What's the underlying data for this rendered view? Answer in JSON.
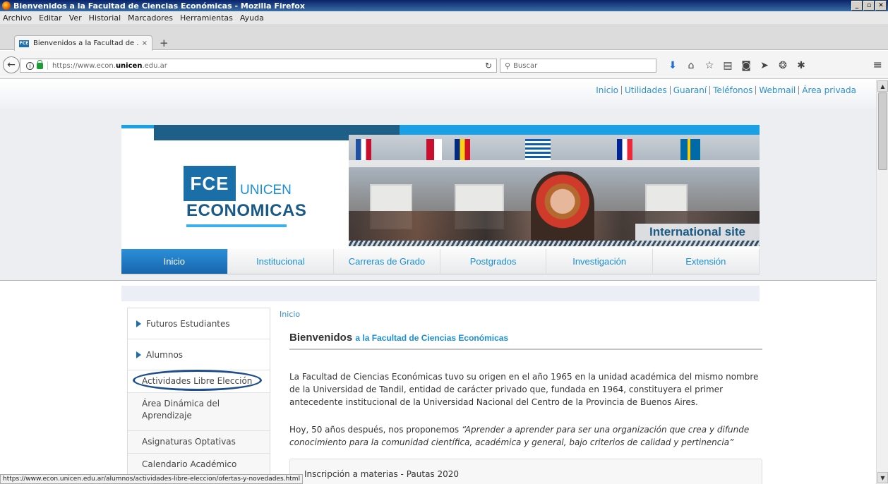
{
  "window": {
    "title": "Bienvenidos a la Facultad de Ciencias Económicas - Mozilla Firefox",
    "buttons": {
      "minimize": "_",
      "maximize": "▫",
      "close": "✕"
    }
  },
  "menu": [
    "Archivo",
    "Editar",
    "Ver",
    "Historial",
    "Marcadores",
    "Herramientas",
    "Ayuda"
  ],
  "tab": {
    "favicon": "FCE",
    "title": "Bienvenidos a la Facultad de ...",
    "close": "×",
    "new_tab": "+"
  },
  "navbar": {
    "url_prefix": "https://www.econ.",
    "url_domain": "unicen",
    "url_suffix": ".edu.ar",
    "search_placeholder": "Buscar",
    "icons": [
      "download-icon",
      "home-icon",
      "bookmark-star-icon",
      "reading-list-icon",
      "pocket-icon",
      "send-icon",
      "extension-icon",
      "addon-icon"
    ]
  },
  "page": {
    "top_links": [
      "Inicio",
      "Utilidades",
      "Guaraní",
      "Teléfonos",
      "Webmail",
      "Área privada"
    ],
    "logo": {
      "fce": "FCE",
      "unicen": "UNICEN",
      "economicas": "ECONOMICAS"
    },
    "hero_caption": "International site",
    "main_nav": [
      "Inicio",
      "Institucional",
      "Carreras de Grado",
      "Postgrados",
      "Investigación",
      "Extensión"
    ],
    "sidebar": {
      "section1": "Futuros Estudiantes",
      "section2": "Alumnos",
      "items": [
        "Actividades Libre Elección",
        "Área Dinámica del Aprendizaje",
        "Asignaturas Optativas",
        "Calendario Académico"
      ]
    },
    "breadcrumb": "Inicio",
    "title_main": "Bienvenidos",
    "title_sub": "a la Facultad de Ciencias Económicas",
    "para1": "La Facultad de Ciencias Económicas tuvo su origen en el año 1965 en la unidad académica del mismo nombre de la Universidad de Tandil, entidad de carácter privado que, fundada en 1964, constituyera el primer antecedente institucional de la Universidad Nacional del Centro de la Provincia de Buenos Aires.",
    "para2_intro": "Hoy, 50 años después, nos proponemos ",
    "para2_quote": "“Aprender a aprender para ser una organización que crea y difunde conocimiento para la comunidad científica, académica y general, bajo criterios de calidad y pertinencia”",
    "boxed_item": "Inscripción a materias - Pautas 2020"
  },
  "status_url": "https://www.econ.unicen.edu.ar/alumnos/actividades-libre-eleccion/ofertas-y-novedades.html",
  "colors": {
    "accent": "#1a8fd6",
    "brand_dark": "#1a5a86",
    "nav_active": "#1866ad",
    "highlight_oval": "#1f4e8c"
  }
}
